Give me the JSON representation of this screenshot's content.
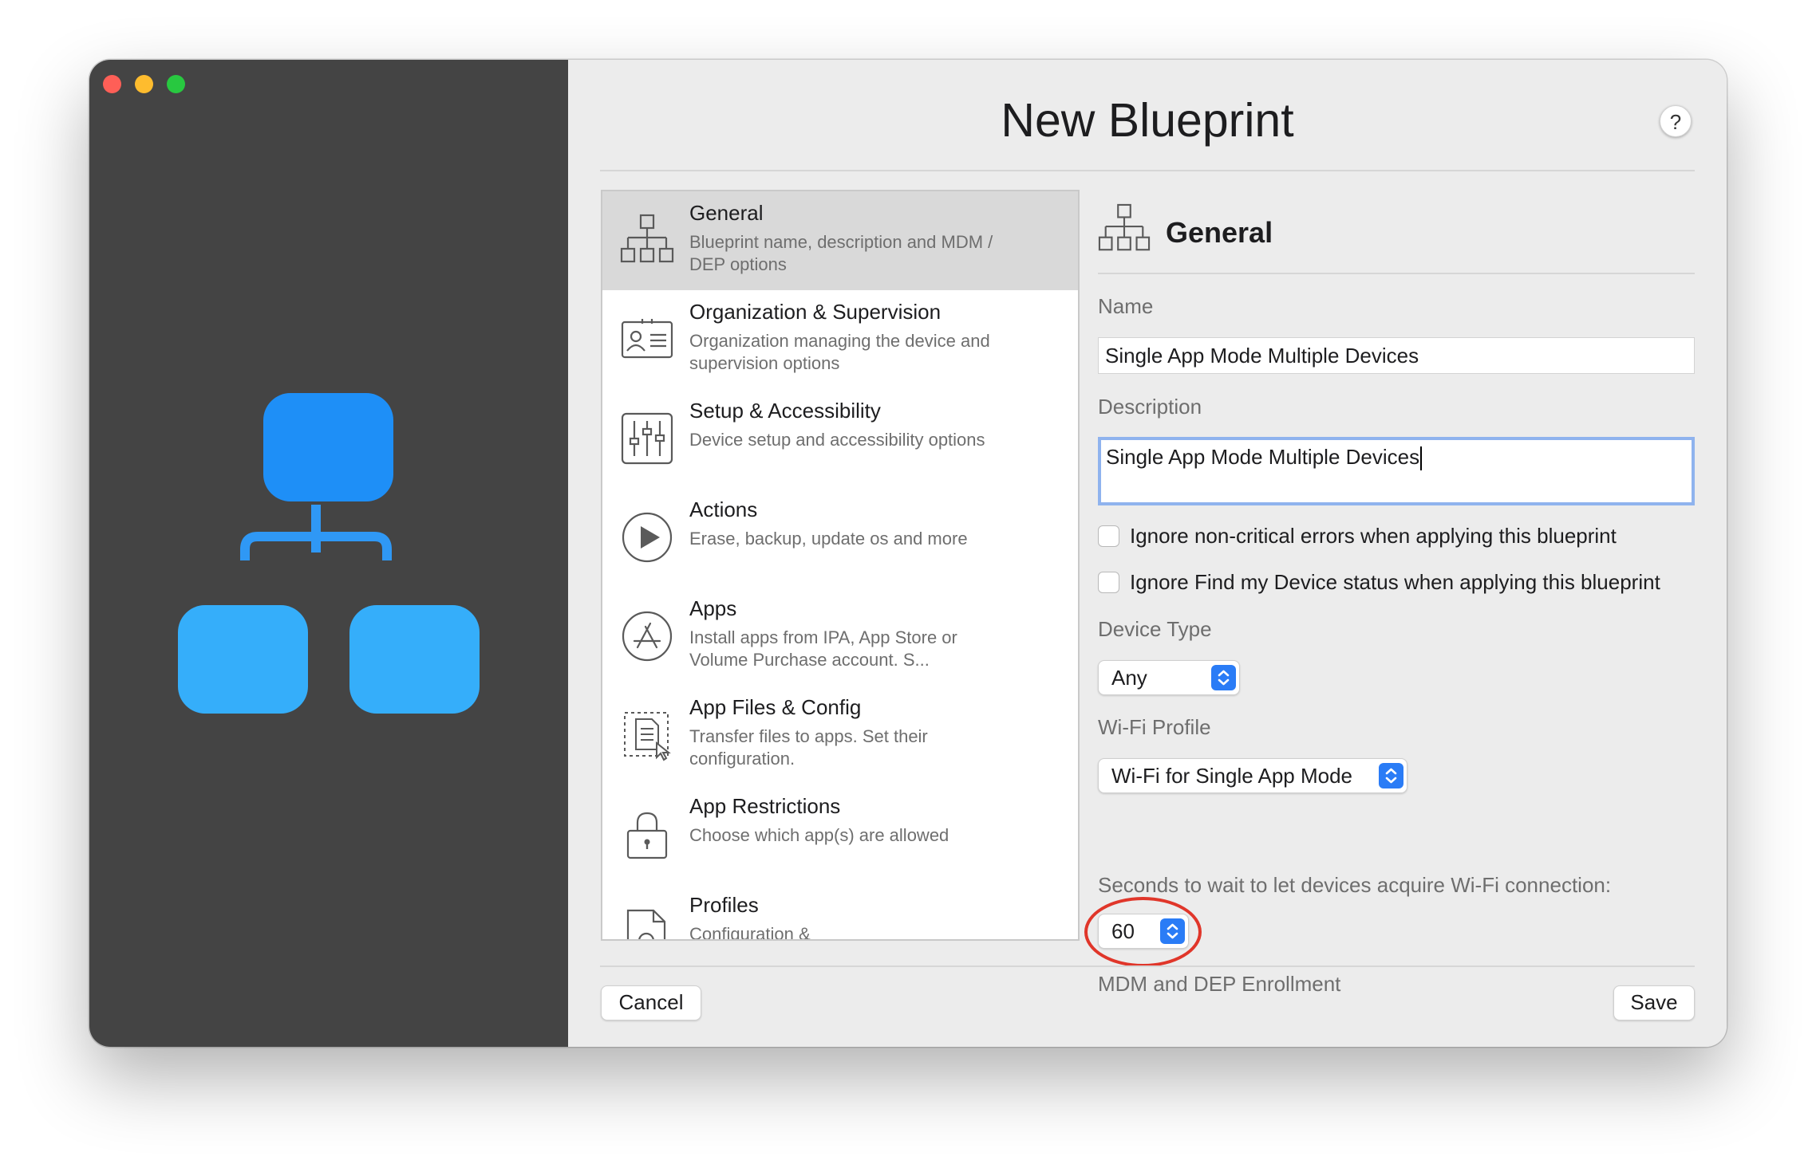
{
  "window": {
    "title": "New Blueprint",
    "help_label": "?"
  },
  "sidebar": {
    "items": [
      {
        "title": "General",
        "desc": "Blueprint name, description and MDM / DEP options",
        "icon": "hierarchy-icon"
      },
      {
        "title": "Organization & Supervision",
        "desc": "Organization managing the device and supervision options",
        "icon": "contact-card-icon"
      },
      {
        "title": "Setup & Accessibility",
        "desc": "Device setup and accessibility options",
        "icon": "sliders-icon"
      },
      {
        "title": "Actions",
        "desc": "Erase, backup, update os and more",
        "icon": "play-icon"
      },
      {
        "title": "Apps",
        "desc": "Install apps from IPA, App Store or Volume Purchase account. S...",
        "icon": "app-store-icon"
      },
      {
        "title": "App Files & Config",
        "desc": "Transfer files to apps. Set their configuration.",
        "icon": "document-transfer-icon"
      },
      {
        "title": "App Restrictions",
        "desc": "Choose which app(s) are allowed",
        "icon": "lock-icon"
      },
      {
        "title": "Profiles",
        "desc": "Configuration &",
        "icon": "profile-gear-icon"
      }
    ],
    "selected_index": 0
  },
  "detail": {
    "title": "General",
    "name_label": "Name",
    "name_value": "Single App Mode Multiple Devices",
    "description_label": "Description",
    "description_value": "Single App Mode Multiple Devices",
    "ignore_errors_label": "Ignore non-critical errors when applying this blueprint",
    "ignore_errors_checked": false,
    "ignore_find_label": "Ignore Find my Device status when applying this blueprint",
    "ignore_find_checked": false,
    "device_type_label": "Device Type",
    "device_type_value": "Any",
    "wifi_profile_label": "Wi-Fi Profile",
    "wifi_profile_value": "Wi-Fi for Single App Mode",
    "wifi_wait_label": "Seconds to wait to let devices acquire Wi-Fi connection:",
    "wifi_wait_value": "60",
    "mdm_label": "MDM and DEP Enrollment"
  },
  "footer": {
    "cancel_label": "Cancel",
    "save_label": "Save"
  },
  "colors": {
    "accent": "#2a7cf6",
    "hero_top": "#1e8ff7",
    "hero_bottom": "#35aefa",
    "annotation_ring": "#e0362a",
    "left_pane": "#444444"
  }
}
